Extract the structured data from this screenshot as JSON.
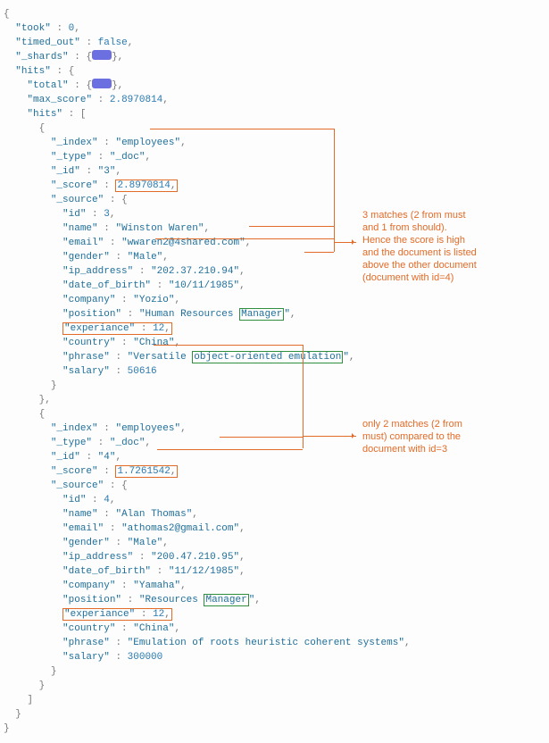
{
  "top": {
    "took_key": "took",
    "took_val": "0",
    "timed_out_key": "timed_out",
    "timed_out_val": "false",
    "shards_key": "_shards",
    "hits_key": "hits",
    "total_key": "total",
    "max_score_key": "max_score",
    "max_score_val": "2.8970814",
    "inner_hits_key": "hits"
  },
  "doc1": {
    "_index": "employees",
    "_type": "_doc",
    "_id": "3",
    "_score": "2.8970814",
    "source": {
      "id": "3",
      "name": "Winston Waren",
      "email": "wwaren2@4shared.com",
      "gender": "Male",
      "ip_address": "202.37.210.94",
      "date_of_birth": "10/11/1985",
      "company": "Yozio",
      "position_lead": "Human Resources ",
      "position_match": "Manager",
      "exp_key": "experiance",
      "exp_val": "12",
      "country": "China",
      "phrase_lead": "Versatile ",
      "phrase_match": "object-oriented emulation",
      "salary": "50616"
    }
  },
  "doc2": {
    "_index": "employees",
    "_type": "_doc",
    "_id": "4",
    "_score": "1.7261542",
    "source": {
      "id": "4",
      "name": "Alan Thomas",
      "email": "athomas2@gmail.com",
      "gender": "Male",
      "ip_address": "200.47.210.95",
      "date_of_birth": "11/12/1985",
      "company": "Yamaha",
      "position_lead": "Resources ",
      "position_match": "Manager",
      "exp_key": "experiance",
      "exp_val": "12",
      "country": "China",
      "phrase": "Emulation of roots heuristic coherent systems",
      "salary": "300000"
    }
  },
  "note1": {
    "l1": "3 matches (2 from must",
    "l2": "and 1 from should).",
    "l3": "Hence the score is high",
    "l4": "and the document is listed",
    "l5": "above the other document",
    "l6": "(document with id=4)"
  },
  "note2": {
    "l1": "only 2 matches (2 from",
    "l2": "must) compared to the",
    "l3": "document with id=3"
  }
}
